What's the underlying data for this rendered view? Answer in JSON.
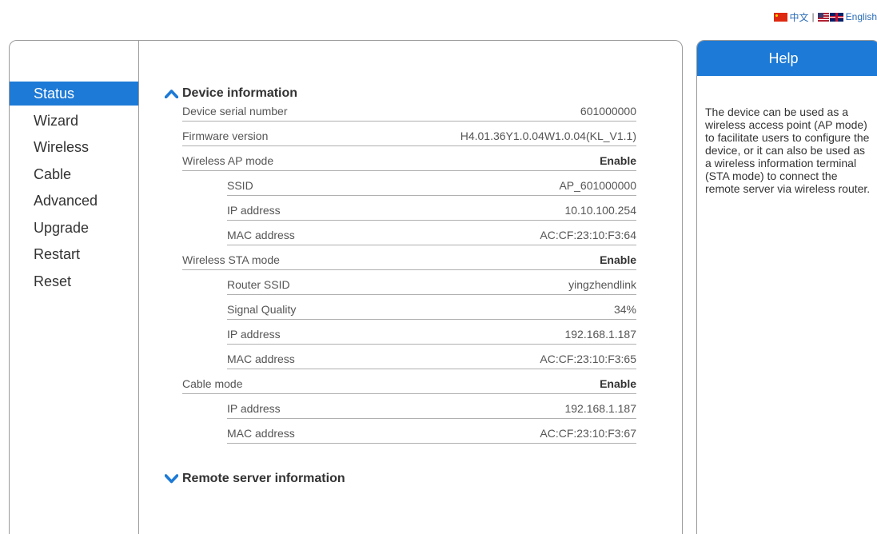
{
  "language": {
    "chinese_label": "中文",
    "separator": "|",
    "english_label": "English"
  },
  "nav": {
    "items": [
      {
        "label": "Status",
        "active": true
      },
      {
        "label": "Wizard"
      },
      {
        "label": "Wireless"
      },
      {
        "label": "Cable"
      },
      {
        "label": "Advanced"
      },
      {
        "label": "Upgrade"
      },
      {
        "label": "Restart"
      },
      {
        "label": "Reset"
      }
    ]
  },
  "device_info": {
    "title": "Device information",
    "rows": [
      {
        "label": "Device serial number",
        "value": "601000000"
      },
      {
        "label": "Firmware version",
        "value": "H4.01.36Y1.0.04W1.0.04(KL_V1.1)"
      },
      {
        "label": "Wireless AP mode",
        "value": "Enable"
      },
      {
        "label": "SSID",
        "value": "AP_601000000"
      },
      {
        "label": "IP address",
        "value": "10.10.100.254"
      },
      {
        "label": "MAC address",
        "value": "AC:CF:23:10:F3:64"
      },
      {
        "label": "Wireless STA mode",
        "value": "Enable"
      },
      {
        "label": "Router SSID",
        "value": "yingzhendlink"
      },
      {
        "label": "Signal Quality",
        "value": "34%"
      },
      {
        "label": "IP address",
        "value": "192.168.1.187"
      },
      {
        "label": "MAC address",
        "value": "AC:CF:23:10:F3:65"
      },
      {
        "label": "Cable mode",
        "value": "Enable"
      },
      {
        "label": "IP address",
        "value": "192.168.1.187"
      },
      {
        "label": "MAC address",
        "value": "AC:CF:23:10:F3:67"
      }
    ]
  },
  "remote_server": {
    "title": "Remote server information"
  },
  "help": {
    "title": "Help",
    "text": "The device can be used as a wireless access point (AP mode) to facilitate users to configure the device, or it can also be used as a wireless information terminal (STA mode) to connect the remote server via wireless router."
  },
  "colors": {
    "accent": "#1d7ad6",
    "border": "#9a9a9a",
    "link": "#2b6cb8"
  }
}
